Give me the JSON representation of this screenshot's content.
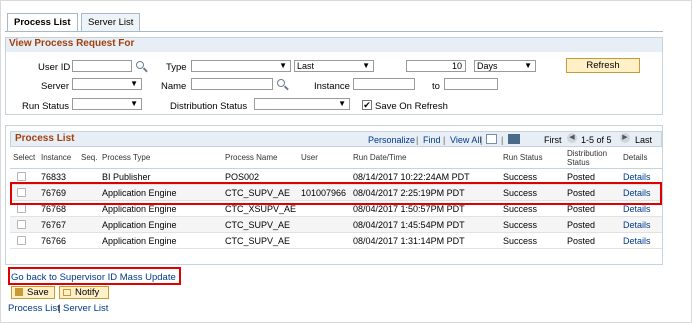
{
  "tabs": {
    "process_list": "Process List",
    "server_list": "Server List"
  },
  "request_section": {
    "title": "View Process Request For",
    "user_id_label": "User ID",
    "user_id_value": "",
    "type_label": "Type",
    "type_value": "",
    "last_value": "Last",
    "last_count": "10",
    "unit_value": "Days",
    "refresh_label": "Refresh",
    "server_label": "Server",
    "server_value": "",
    "name_label": "Name",
    "name_value": "",
    "instance_label": "Instance",
    "instance_from": "",
    "to_label": "to",
    "instance_to": "",
    "run_status_label": "Run Status",
    "run_status_value": "",
    "dist_status_label": "Distribution Status",
    "dist_status_value": "",
    "save_on_refresh_label": "Save On Refresh",
    "save_on_refresh_checked": true
  },
  "process_list": {
    "title": "Process List",
    "personalize": "Personalize",
    "find": "Find",
    "view_all": "View All",
    "first": "First",
    "range": "1-5 of 5",
    "last": "Last",
    "columns": [
      "Select",
      "Instance",
      "Seq.",
      "Process Type",
      "Process Name",
      "User",
      "Run Date/Time",
      "Run Status",
      "Distribution Status",
      "Details"
    ],
    "rows": [
      {
        "instance": "76833",
        "seq": "",
        "type": "BI Publisher",
        "name": "POS002",
        "user": "",
        "datetime": "08/14/2017 10:22:24AM PDT",
        "run_status": "Success",
        "dist_status": "Posted",
        "details": "Details"
      },
      {
        "instance": "76769",
        "seq": "",
        "type": "Application Engine",
        "name": "CTC_SUPV_AE",
        "user": "101007966",
        "datetime": "08/04/2017  2:25:19PM PDT",
        "run_status": "Success",
        "dist_status": "Posted",
        "details": "Details"
      },
      {
        "instance": "76768",
        "seq": "",
        "type": "Application Engine",
        "name": "CTC_XSUPV_AE",
        "user": "",
        "datetime": "08/04/2017  1:50:57PM PDT",
        "run_status": "Success",
        "dist_status": "Posted",
        "details": "Details"
      },
      {
        "instance": "76767",
        "seq": "",
        "type": "Application Engine",
        "name": "CTC_SUPV_AE",
        "user": "",
        "datetime": "08/04/2017  1:45:54PM PDT",
        "run_status": "Success",
        "dist_status": "Posted",
        "details": "Details"
      },
      {
        "instance": "76766",
        "seq": "",
        "type": "Application Engine",
        "name": "CTC_SUPV_AE",
        "user": "",
        "datetime": "08/04/2017  1:31:14PM PDT",
        "run_status": "Success",
        "dist_status": "Posted",
        "details": "Details"
      }
    ]
  },
  "footer": {
    "back_link": "Go back to Supervisor ID Mass Update",
    "save_label": "Save",
    "notify_label": "Notify",
    "process_list_link": "Process List",
    "separator": "|",
    "server_list_link": "Server List"
  },
  "colors": {
    "section_title": "#a0410d",
    "link": "#003a8c",
    "highlight": "#e00000",
    "button_fill": "#fff0c8"
  }
}
